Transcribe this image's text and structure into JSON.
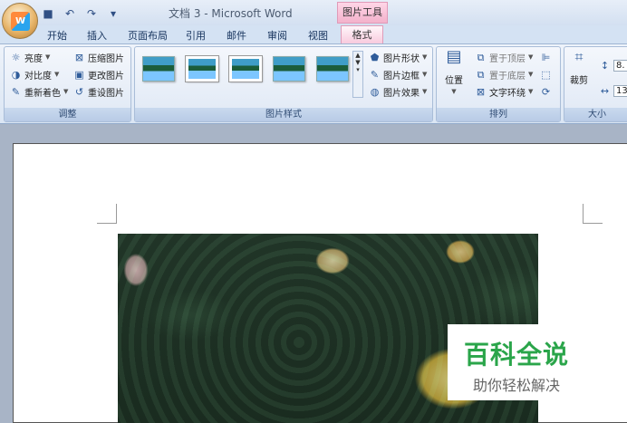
{
  "app": {
    "doc_title": "文档 3 - Microsoft Word",
    "context_tab_header": "图片工具",
    "office_logo": "W"
  },
  "qat": {
    "save_icon": "save-icon",
    "undo_icon": "undo-icon",
    "redo_icon": "redo-icon",
    "customize_icon": "customize-qat-icon"
  },
  "tabs": [
    "开始",
    "插入",
    "页面布局",
    "引用",
    "邮件",
    "审阅",
    "视图"
  ],
  "active_tab": "格式",
  "ribbon": {
    "adjust": {
      "label": "调整",
      "brightness": "亮度",
      "contrast": "对比度",
      "recolor": "重新着色",
      "compress": "压缩图片",
      "change": "更改图片",
      "reset": "重设图片"
    },
    "styles": {
      "label": "图片样式",
      "shape": "图片形状",
      "border": "图片边框",
      "effects": "图片效果"
    },
    "arrange": {
      "label": "排列",
      "position": "位置",
      "front": "置于顶层",
      "back": "置于底层",
      "wrap": "文字环绕"
    },
    "size": {
      "label": "大小",
      "crop": "裁剪",
      "height_val": "8.",
      "width_val": "13"
    }
  },
  "watermark": {
    "title": "百科全说",
    "subtitle": "助你轻松解决"
  },
  "colors": {
    "accent": "#2aa54a",
    "context": "#f3b1cb"
  }
}
